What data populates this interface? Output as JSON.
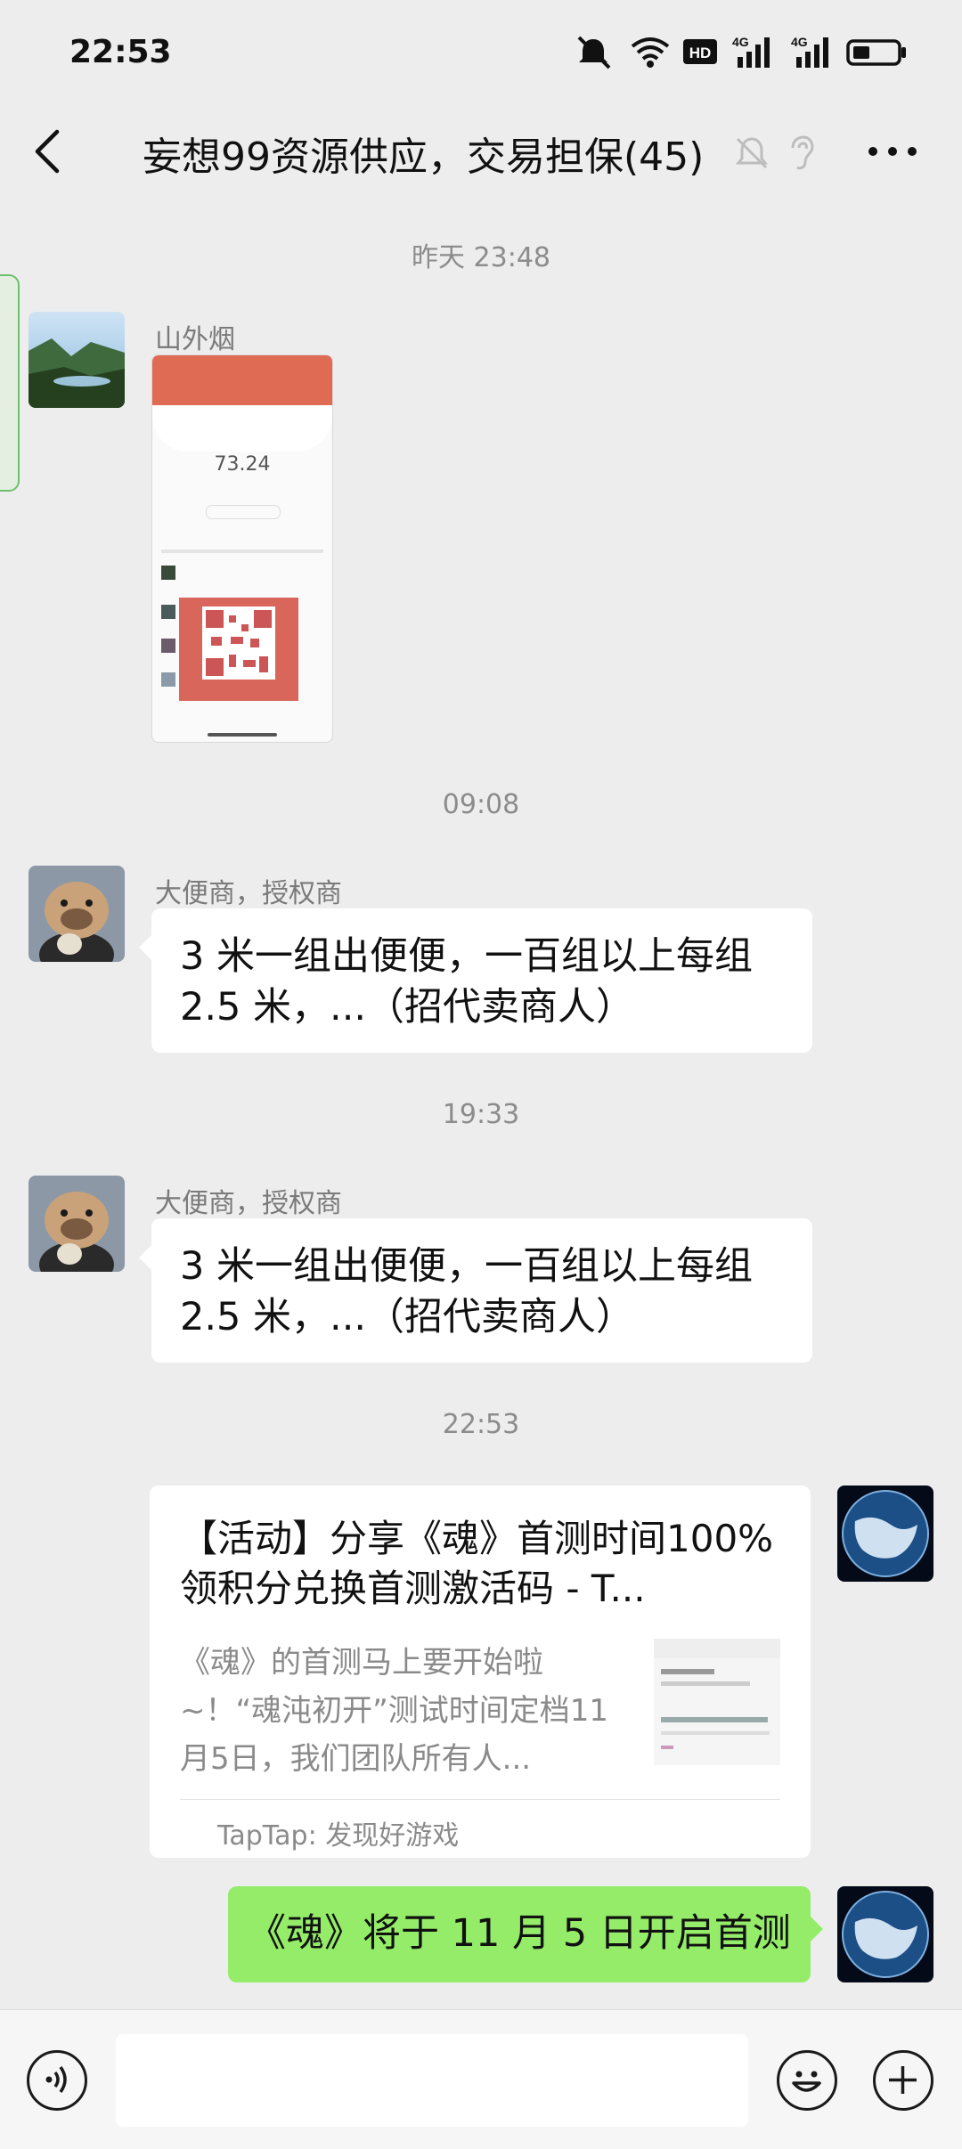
{
  "status_bar": {
    "time": "22:53",
    "icons": [
      "mute-icon",
      "wifi-icon",
      "hd-icon",
      "signal-4g-icon",
      "signal-4g-icon",
      "battery-icon"
    ]
  },
  "header": {
    "title": "妄想99资源供应，交易担保(45)",
    "icons": [
      "back-icon",
      "mute-bell-icon",
      "ear-icon",
      "more-icon"
    ]
  },
  "messages": [
    {
      "timestamp": "昨天 23:48"
    },
    {
      "sender": "山外烟",
      "type": "image",
      "image_text": "73.24"
    },
    {
      "timestamp": "09:08"
    },
    {
      "sender": "大便商，授权商",
      "line1": "3 米一组出便便，一百组以上每组",
      "line2": "2.5 米，...（招代卖商人）"
    },
    {
      "timestamp": "19:33"
    },
    {
      "sender": "大便商，授权商",
      "line1": "3 米一组出便便，一百组以上每组",
      "line2": "2.5 米，...（招代卖商人）"
    },
    {
      "timestamp": "22:53"
    },
    {
      "type": "link_card",
      "title": "【活动】分享《魂》首测时间100%领积分兑换首测激活码 - T...",
      "description": "《魂》的首测马上要开始啦~！“魂沌初开”测试时间定档11月5日，我们团队所有人...",
      "source": "TapTap: 发现好游戏"
    },
    {
      "type": "text",
      "self": true,
      "text": "《魂》将于 11 月 5 日开启首测"
    }
  ],
  "colors": {
    "background": "#ededed",
    "self_bubble": "#95ec69",
    "other_bubble": "#ffffff",
    "meta_text": "#8c8c8c"
  }
}
